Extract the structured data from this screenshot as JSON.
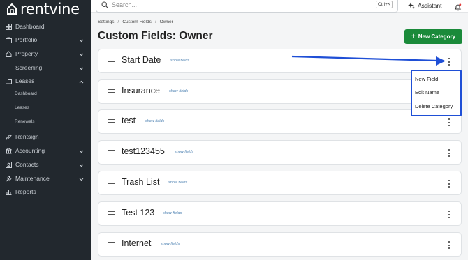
{
  "brand": {
    "name": "rentvine"
  },
  "sidebar": {
    "items": [
      {
        "label": "Dashboard",
        "icon": "dashboard-icon",
        "chevron": false
      },
      {
        "label": "Portfolio",
        "icon": "briefcase-icon",
        "chevron": true
      },
      {
        "label": "Property",
        "icon": "home-icon",
        "chevron": true
      },
      {
        "label": "Screening",
        "icon": "list-icon",
        "chevron": true
      },
      {
        "label": "Leases",
        "icon": "folder-icon",
        "chevron": true,
        "expanded": true
      },
      {
        "label": "Rentsign",
        "icon": "pen-icon",
        "chevron": false
      },
      {
        "label": "Accounting",
        "icon": "bank-icon",
        "chevron": true
      },
      {
        "label": "Contacts",
        "icon": "contacts-icon",
        "chevron": true
      },
      {
        "label": "Maintenance",
        "icon": "wrench-icon",
        "chevron": true
      },
      {
        "label": "Reports",
        "icon": "chart-icon",
        "chevron": false
      }
    ],
    "leases_sub": [
      "Dashboard",
      "Leases",
      "Renewals"
    ]
  },
  "topbar": {
    "search_placeholder": "Search...",
    "shortcut": "Ctrl+K",
    "assistant_label": "Assistant"
  },
  "breadcrumb": [
    "Settings",
    "Custom Fields",
    "Owner"
  ],
  "page_title": "Custom Fields: Owner",
  "new_category_label": "New Category",
  "categories": [
    {
      "name": "Start Date",
      "action": "show fields"
    },
    {
      "name": "Insurance",
      "action": "show fields"
    },
    {
      "name": "test",
      "action": "show fields"
    },
    {
      "name": "test123455",
      "action": "show fields"
    },
    {
      "name": "Trash List",
      "action": "show fields"
    },
    {
      "name": "Test 123",
      "action": "show fields"
    },
    {
      "name": "Internet",
      "action": "show fields"
    }
  ],
  "category_menu": [
    "New Field",
    "Edit Name",
    "Delete Category"
  ],
  "colors": {
    "sidebar": "#22282e",
    "primary_button": "#1a8a3a",
    "annotation": "#1f4fd6",
    "link": "#4a7fb0"
  }
}
